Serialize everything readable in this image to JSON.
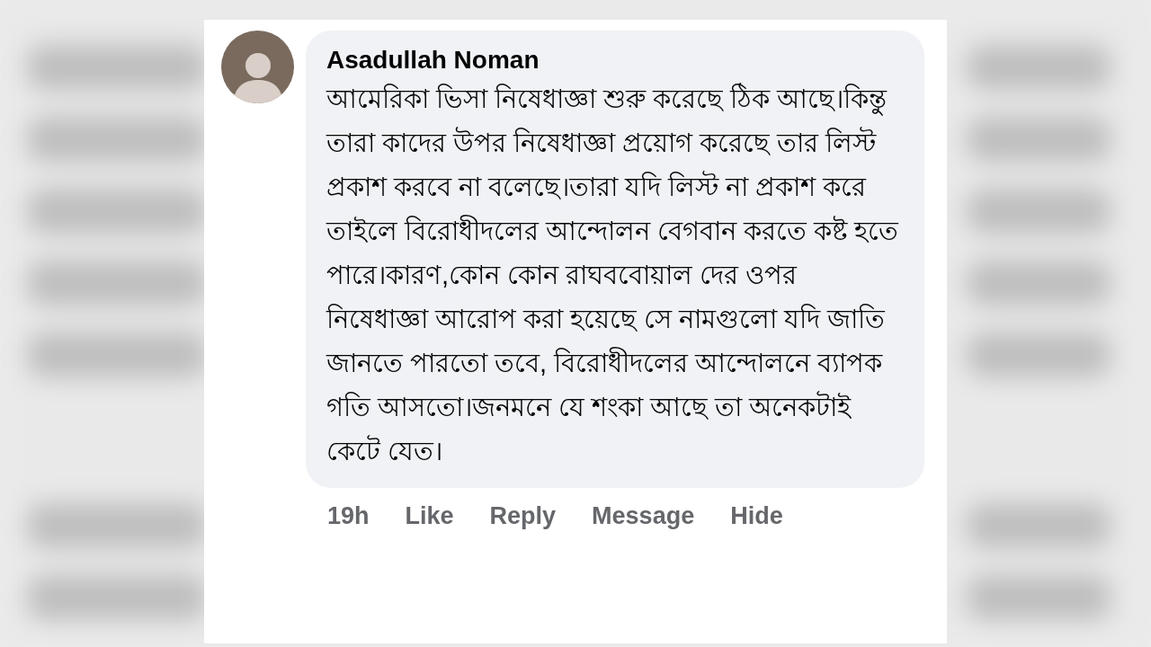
{
  "comment": {
    "author": "Asadullah Noman",
    "text": "আমেরিকা ভিসা নিষেধাজ্ঞা শুরু করেছে ঠিক আছে।কিন্তু তারা কাদের উপর নিষেধাজ্ঞা প্রয়োগ করেছে তার লিস্ট প্রকাশ করবে না বলেছে।তারা যদি লিস্ট না প্রকাশ করে তাইলে বিরোধীদলের আন্দোলন বেগবান করতে কষ্ট হতে পারে।কারণ,কোন কোন রাঘববোয়াল দের ওপর নিষেধাজ্ঞা আরোপ করা হয়েছে সে নামগুলো যদি জাতি জানতে পারতো তবে, বিরোধীদলের আন্দোলনে ব্যাপক গতি আসতো।জনমনে যে শংকা আছে তা অনেকটাই কেটে যেত।",
    "timestamp": "19h",
    "actions": [
      "Like",
      "Reply",
      "Message",
      "Hide"
    ]
  }
}
